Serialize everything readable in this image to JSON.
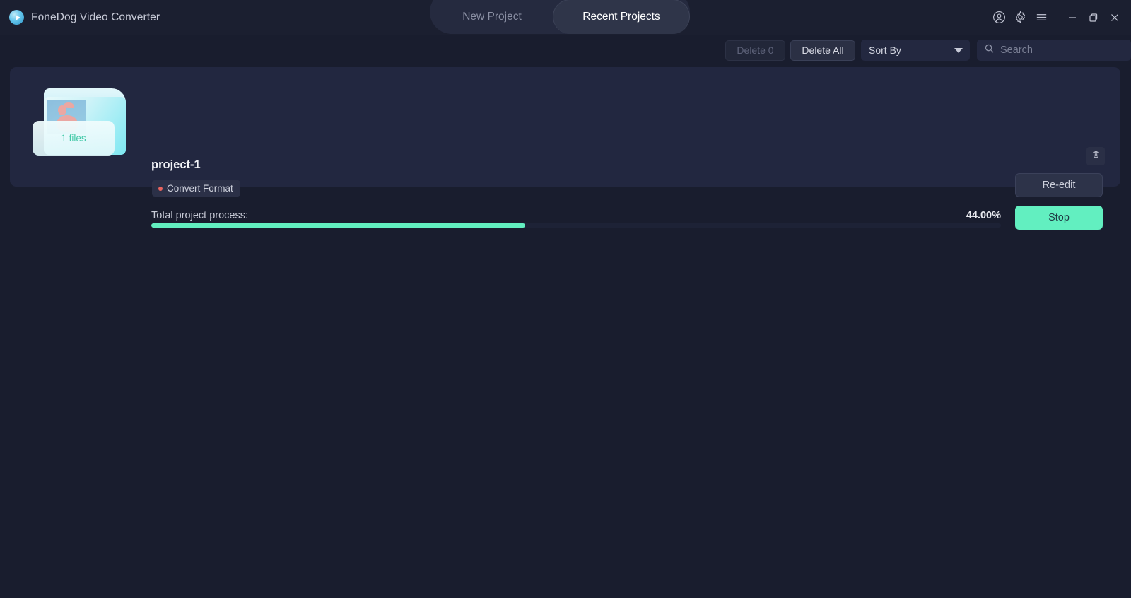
{
  "app": {
    "title": "FoneDog Video Converter",
    "logo_icon": "play-circle-icon"
  },
  "tabs": [
    {
      "id": "new-project",
      "label": "New Project",
      "active": false
    },
    {
      "id": "recent-projects",
      "label": "Recent Projects",
      "active": true
    }
  ],
  "window_controls": {
    "account_icon": "account-icon",
    "settings_icon": "gear-icon",
    "menu_icon": "hamburger-menu-icon",
    "minimize_icon": "minimize-icon",
    "maximize_icon": "maximize-restore-icon",
    "close_icon": "close-icon"
  },
  "toolbar": {
    "delete_selected_label": "Delete 0",
    "delete_all_label": "Delete All",
    "sort_by_label": "Sort By",
    "sort_caret_icon": "chevron-down-icon",
    "search_icon": "search-icon",
    "search_value": "",
    "search_placeholder": "Search"
  },
  "project": {
    "name": "project-1",
    "badge_label": "Convert Format",
    "badge_dot_color": "#e8645f",
    "files_label": "1 files",
    "progress_label": "Total project process:",
    "progress_percent_text": "44.00%",
    "progress_percent_value": 44.0,
    "reedit_label": "Re-edit",
    "stop_label": "Stop",
    "delete_icon": "trash-icon",
    "thumbnail_icon": "folder-thumbnail-icon"
  },
  "colors": {
    "page_background": "#191d2e",
    "card_background": "#222740",
    "accent_mint": "#62efc0",
    "accent_cyan": "#7ee8f2",
    "badge_dot": "#e8645f",
    "files_text": "#43c9a8"
  }
}
